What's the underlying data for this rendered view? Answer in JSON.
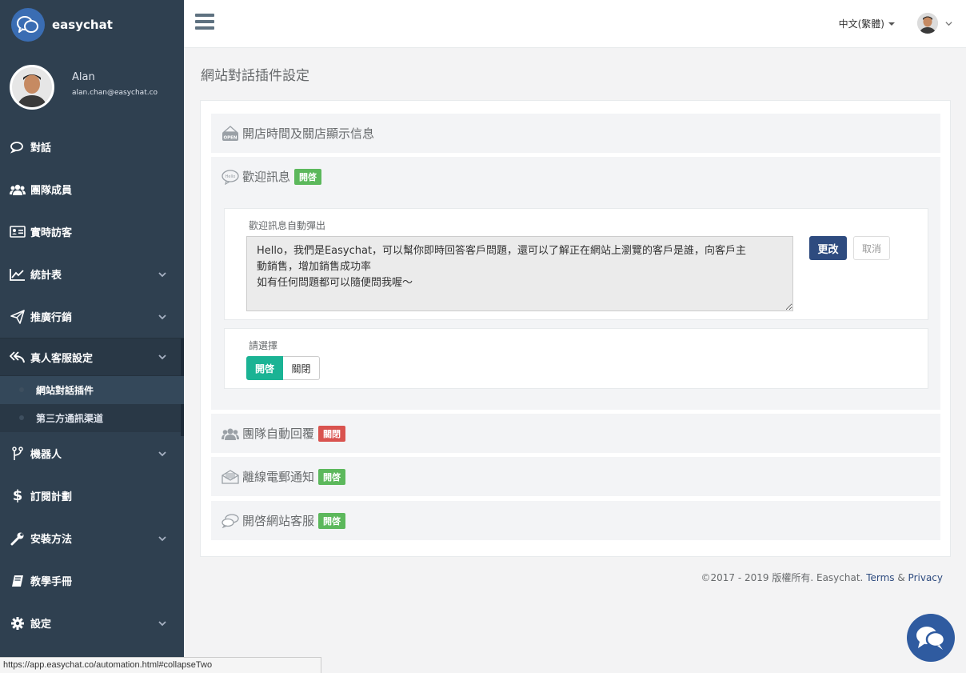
{
  "brand": {
    "name": "easychat"
  },
  "profile": {
    "name": "Alan",
    "email": "alan.chan@easychat.co"
  },
  "sidebar": {
    "items": [
      {
        "label": "對話",
        "icon": "chat-icon",
        "has_children": false
      },
      {
        "label": "團隊成員",
        "icon": "team-icon",
        "has_children": false
      },
      {
        "label": "實時訪客",
        "icon": "id-card-icon",
        "has_children": false
      },
      {
        "label": "統計表",
        "icon": "line-chart-icon",
        "has_children": true
      },
      {
        "label": "推廣行銷",
        "icon": "paper-plane-icon",
        "has_children": true
      },
      {
        "label": "真人客服設定",
        "icon": "reply-all-icon",
        "has_children": true,
        "active": true
      },
      {
        "label": "機器人",
        "icon": "branch-icon",
        "has_children": true
      },
      {
        "label": "訂閱計劃",
        "icon": "dollar-icon",
        "has_children": false
      },
      {
        "label": "安裝方法",
        "icon": "wrench-icon",
        "has_children": true
      },
      {
        "label": "教學手冊",
        "icon": "book-icon",
        "has_children": false
      },
      {
        "label": "設定",
        "icon": "gear-icon",
        "has_children": true
      }
    ],
    "subitems": [
      {
        "label": "網站對話插件",
        "current": true
      },
      {
        "label": "第三方通訊渠道",
        "current": false
      }
    ]
  },
  "topbar": {
    "language": "中文(繁體)"
  },
  "page": {
    "title": "網站對話插件設定"
  },
  "sections": [
    {
      "title": "開店時間及關店顯示信息",
      "icon": "open-sign-icon",
      "badge": ""
    },
    {
      "title": "歡迎訊息",
      "icon": "hello-bubble-icon",
      "badge": "開啓",
      "badge_state": "on"
    },
    {
      "title": "團隊自動回覆",
      "icon": "team-icon",
      "badge": "關閉",
      "badge_state": "off"
    },
    {
      "title": "離線電郵通知",
      "icon": "envelope-icon",
      "badge": "開啓",
      "badge_state": "on"
    },
    {
      "title": "開啓網站客服",
      "icon": "chat-bubbles-icon",
      "badge": "開啓",
      "badge_state": "on"
    }
  ],
  "welcome": {
    "field_label": "歡迎訊息自動彈出",
    "message": "Hello，我們是Easychat，可以幫你即時回答客戶問題，還可以了解正在網站上瀏覽的客戶是誰，向客戶主\n動銷售，增加銷售成功率\n如有任何問題都可以隨便問我喔～",
    "change_label": "更改",
    "cancel_label": "取消",
    "select_label": "請選擇",
    "toggle_on": "開啓",
    "toggle_off": "關閉",
    "selected": "開啓"
  },
  "footer": {
    "copyright": "©2017 - 2019 版權所有. Easychat.",
    "terms": "Terms",
    "amp": "&",
    "privacy": "Privacy"
  },
  "status_url": "https://app.easychat.co/automation.html#collapseTwo",
  "colors": {
    "sidebar": "#2f4050",
    "primary": "#2e4b7f",
    "success": "#5cb85c",
    "danger": "#d9534f",
    "teal": "#1ab394"
  }
}
